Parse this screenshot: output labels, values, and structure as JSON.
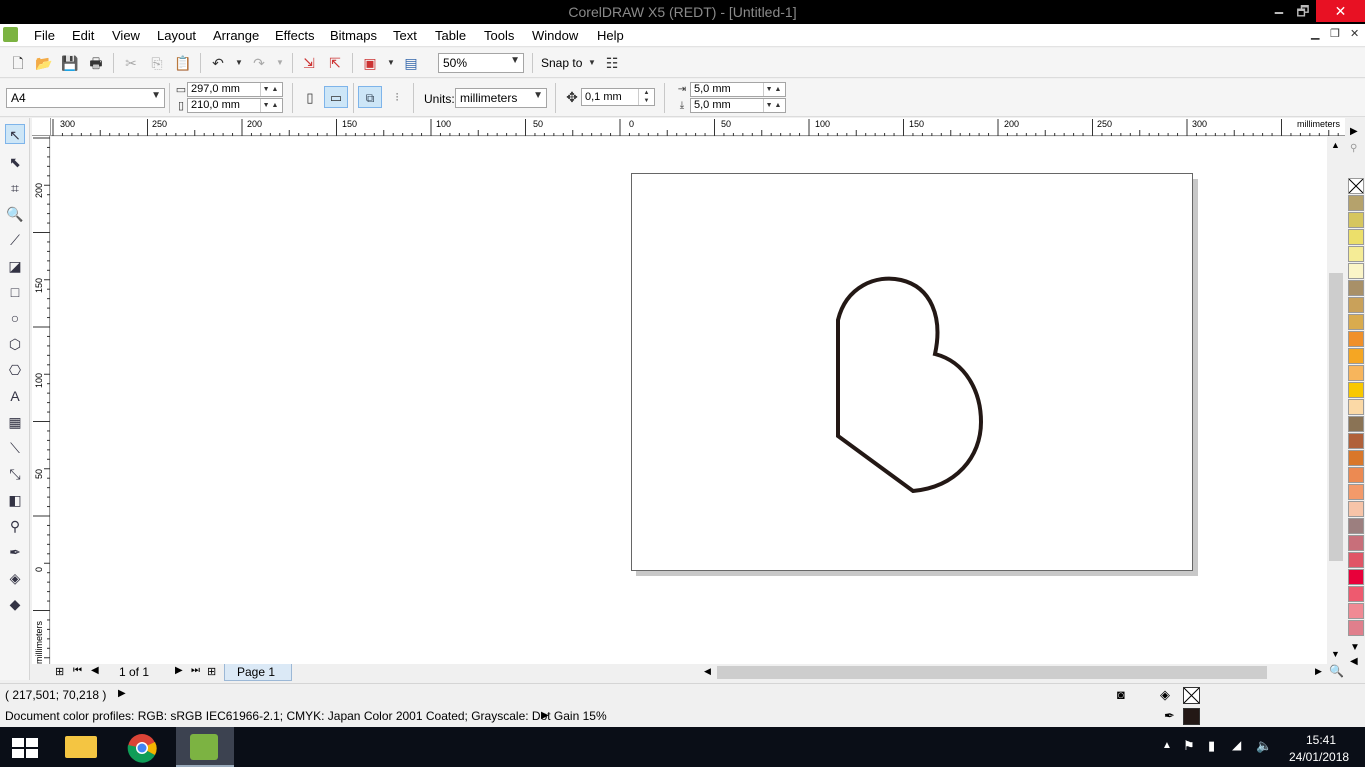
{
  "window": {
    "title": "CorelDRAW X5 (REDT) - [Untitled-1]",
    "min": "🗕",
    "max": "🗗",
    "close": "✕"
  },
  "menu": [
    {
      "label": "File"
    },
    {
      "label": "Edit"
    },
    {
      "label": "View"
    },
    {
      "label": "Layout"
    },
    {
      "label": "Arrange"
    },
    {
      "label": "Effects"
    },
    {
      "label": "Bitmaps"
    },
    {
      "label": "Text"
    },
    {
      "label": "Table"
    },
    {
      "label": "Tools"
    },
    {
      "label": "Window"
    },
    {
      "label": "Help"
    }
  ],
  "standard_toolbar": {
    "zoom": "50%",
    "snap_to": "Snap to"
  },
  "property_bar": {
    "page_size": "A4",
    "width": "297,0 mm",
    "height": "210,0 mm",
    "units_label": "Units:",
    "units": "millimeters",
    "nudge": "0,1 mm",
    "dup_x": "5,0 mm",
    "dup_y": "5,0 mm"
  },
  "rulers": {
    "h_labels": [
      "300",
      "250",
      "200",
      "150",
      "100",
      "50",
      "0",
      "50",
      "100",
      "150",
      "200",
      "250",
      "300"
    ],
    "h_units": "millimeters",
    "v_labels": [
      "200",
      "150",
      "100",
      "50",
      "0"
    ],
    "v_units": "millimeters"
  },
  "page_nav": {
    "count": "1 of 1",
    "tab": "Page 1"
  },
  "status": {
    "coords": "( 217,501; 70,218 )",
    "profiles": "Document color profiles: RGB: sRGB IEC61966-2.1; CMYK: Japan Color 2001 Coated; Grayscale: Dot Gain 15%"
  },
  "palette": [
    "#b5a26c",
    "#d6c65f",
    "#ecdf6a",
    "#f5ec96",
    "#fbf5c8",
    "#a89068",
    "#c9a15a",
    "#d9ab4e",
    "#f0902a",
    "#f5a623",
    "#f7b55c",
    "#f9c800",
    "#fbd9a6",
    "#8a7355",
    "#b0613a",
    "#d9772a",
    "#ec8a52",
    "#f39a6a",
    "#f7c4a8",
    "#9c7f7f",
    "#c86f7a",
    "#e05566",
    "#e8003a",
    "#ee5a6f",
    "#f08a94",
    "#e07f8c"
  ],
  "taskbar": {
    "time": "15:41",
    "date": "24/01/2018"
  }
}
